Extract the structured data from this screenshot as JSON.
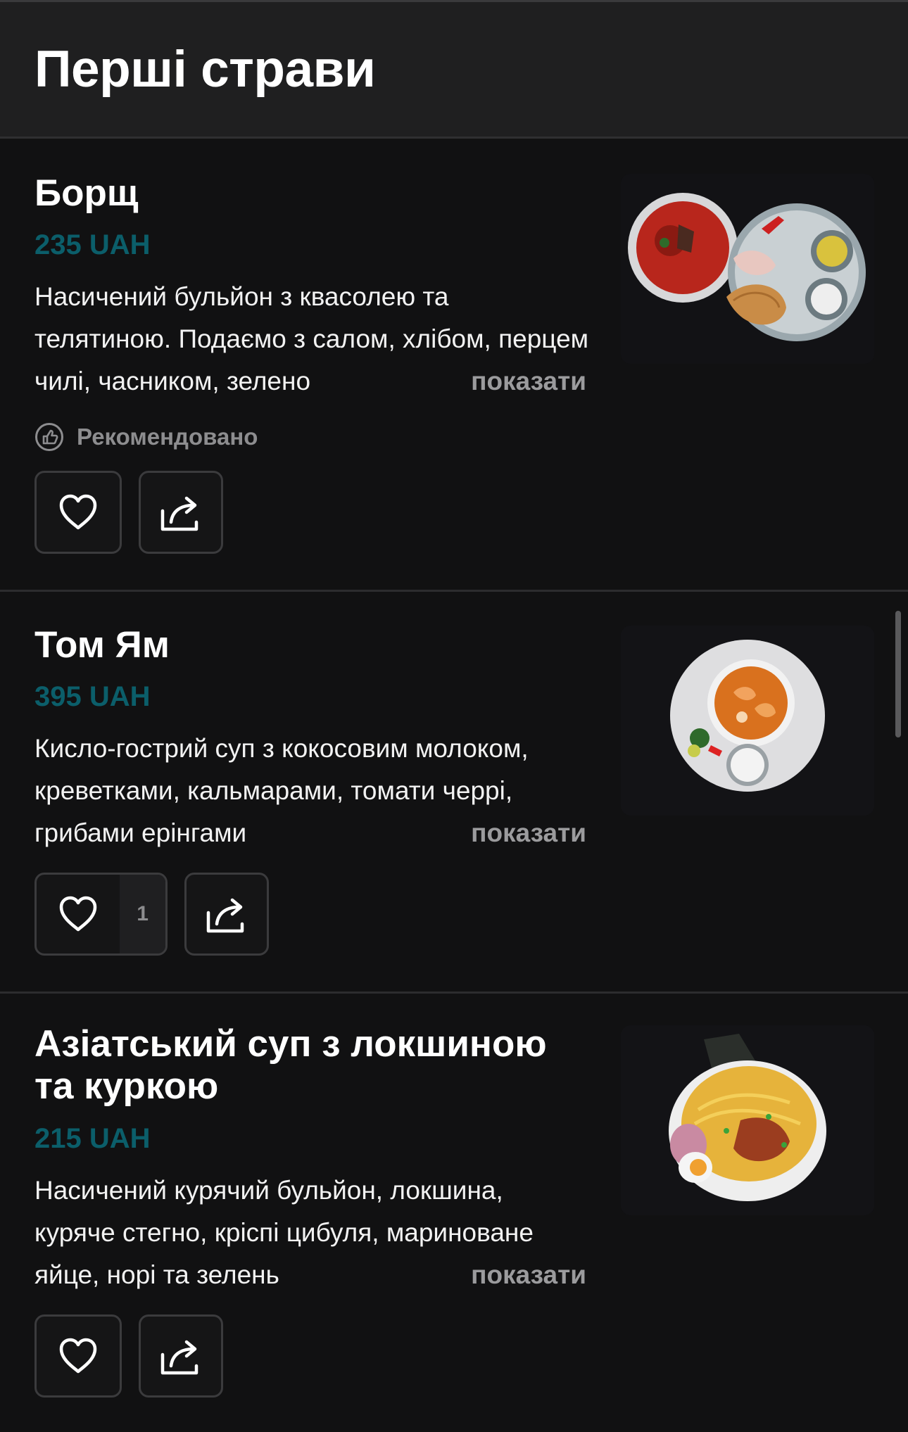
{
  "header": {
    "title": "Перші страви"
  },
  "items": [
    {
      "title": "Борщ",
      "price": "235 UAH",
      "description": "Насичений бульйон з квасолею та телятиною. Подаємо з салом, хлібом, перцем чилі, часником, зелено",
      "show_more": "показати",
      "recommended_label": "Рекомендовано",
      "likes": ""
    },
    {
      "title": "Том Ям",
      "price": "395 UAH",
      "description": "Кисло-гострий суп з кокосовим молоком, креветками, кальмарами, томати черрі, грибами ерінгами",
      "show_more": "показати",
      "likes": "1"
    },
    {
      "title": "Азіатський суп з локшиною та куркою",
      "price": "215 UAH",
      "description": "Насичений курячий бульйон, локшина, куряче стегно, кріспі цибуля, мариноване яйце, норі та зелень",
      "show_more": "показати",
      "likes": ""
    }
  ],
  "icons": {
    "like": "heart-icon",
    "share": "share-icon",
    "recommended": "thumbs-up-circle-icon"
  },
  "colors": {
    "background": "#111112",
    "header_background": "#1f1f20",
    "price": "#0b5e6a",
    "muted_text": "#8d8d8f"
  }
}
